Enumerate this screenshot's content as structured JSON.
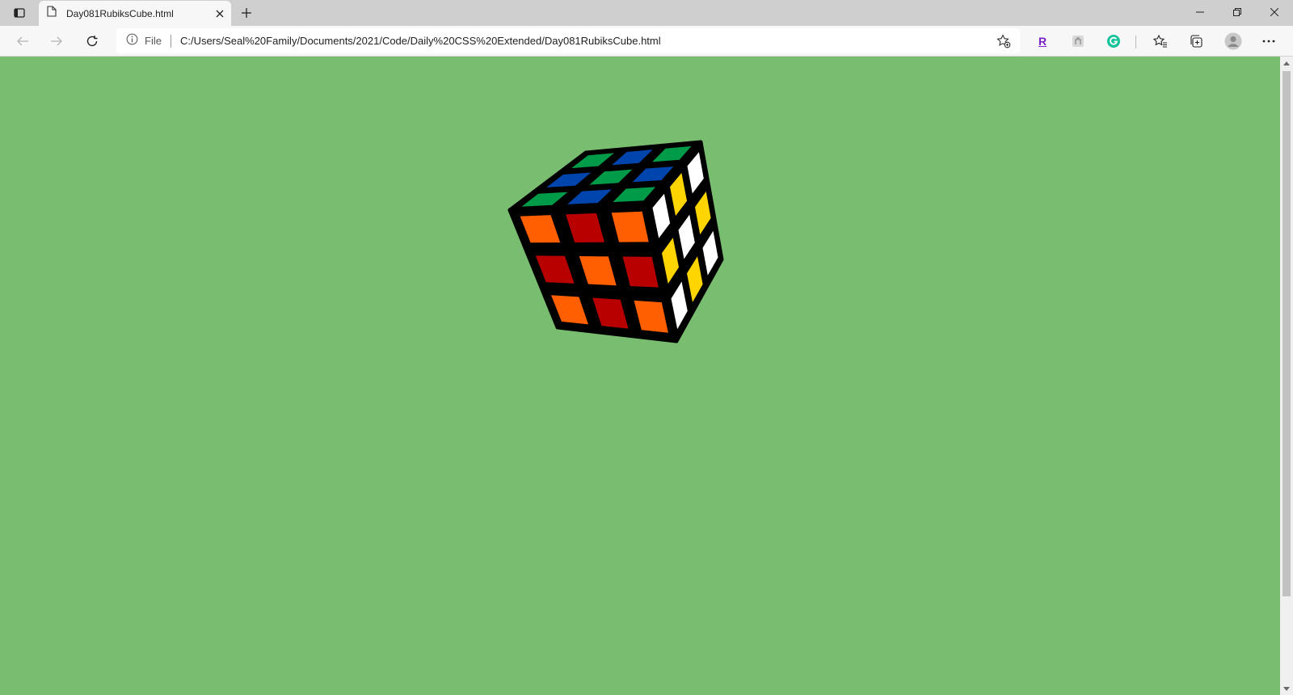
{
  "browser": {
    "tab": {
      "title": "Day081RubiksCube.html"
    },
    "address_bar": {
      "scheme_label": "File",
      "url": "C:/Users/Seal%20Family/Documents/2021/Code/Daily%20CSS%20Extended/Day081RubiksCube.html"
    },
    "extensions": [
      {
        "name": "R",
        "color": "#7b22c9"
      },
      {
        "name": "extension-puzzle-icon",
        "color": "#9a9a9a"
      },
      {
        "name": "grammarly-icon",
        "color": "#15c39a"
      }
    ],
    "icons": {
      "tab_actions": "tab-actions-icon",
      "page": "page-icon",
      "close": "close-icon",
      "new_tab": "plus-icon",
      "back": "arrow-left-icon",
      "forward": "arrow-right-icon",
      "refresh": "refresh-icon",
      "info": "info-icon",
      "add_favorite": "star-plus-icon",
      "favorites": "favorites-icon",
      "collections": "collections-icon",
      "profile": "profile-icon",
      "more": "more-icon"
    }
  },
  "page": {
    "background": "#79bd71",
    "cube": {
      "colors": {
        "orange": "#ff5f00",
        "red": "#b90000",
        "green": "#009b48",
        "blue": "#0045ad",
        "white": "#ffffff",
        "yellow": "#ffd500",
        "outline": "#000000"
      },
      "faces": {
        "top": [
          "green",
          "blue",
          "green",
          "blue",
          "green",
          "blue",
          "green",
          "blue",
          "green"
        ],
        "front": [
          "orange",
          "red",
          "orange",
          "red",
          "orange",
          "red",
          "orange",
          "red",
          "orange"
        ],
        "right": [
          "white",
          "yellow",
          "white",
          "yellow",
          "white",
          "yellow",
          "white",
          "yellow",
          "white"
        ]
      }
    }
  }
}
